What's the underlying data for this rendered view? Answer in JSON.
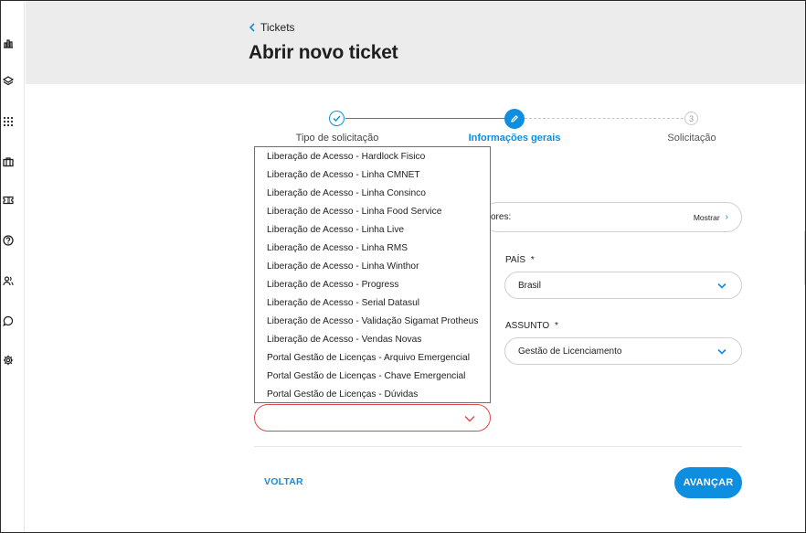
{
  "breadcrumb": {
    "label": "Tickets"
  },
  "page": {
    "title": "Abrir novo ticket"
  },
  "sidebar": {
    "icons": [
      "dashboard-icon",
      "layers-icon",
      "apps-grid-icon",
      "briefcase-icon",
      "ticket-icon",
      "help-icon",
      "users-icon",
      "chat-icon",
      "settings-icon"
    ]
  },
  "stepper": {
    "steps": [
      {
        "label": "Tipo de solicitação",
        "state": "done"
      },
      {
        "label": "Informações gerais",
        "state": "active"
      },
      {
        "label": "Solicitação",
        "state": "pending",
        "number": "3"
      }
    ]
  },
  "info": {
    "text": "ores:",
    "show_label": "Mostrar"
  },
  "country": {
    "label": "PAÍS",
    "required": "*",
    "value": "Brasil"
  },
  "subject": {
    "label": "ASSUNTO",
    "required": "*",
    "value": "Gestão de Licenciamento"
  },
  "dropdown": {
    "options": [
      "Liberação de Acesso - Hardlock Fisico",
      "Liberação de Acesso - Linha CMNET",
      "Liberação de Acesso - Linha Consinco",
      "Liberação de Acesso - Linha Food Service",
      "Liberação de Acesso - Linha Live",
      "Liberação de Acesso - Linha RMS",
      "Liberação de Acesso - Linha Winthor",
      "Liberação de Acesso - Progress",
      "Liberação de Acesso - Serial Datasul",
      "Liberação de Acesso - Validação Sigamat Protheus",
      "Liberação de Acesso - Vendas Novas",
      "Portal Gestão de Licenças - Arquivo Emergencial",
      "Portal Gestão de Licenças - Chave Emergencial",
      "Portal Gestão de Licenças - Dúvidas"
    ]
  },
  "actions": {
    "back": "VOLTAR",
    "next": "AVANÇAR"
  },
  "colors": {
    "accent": "#0d8ee0",
    "error": "#e0474c",
    "header_bg": "#ececec"
  }
}
